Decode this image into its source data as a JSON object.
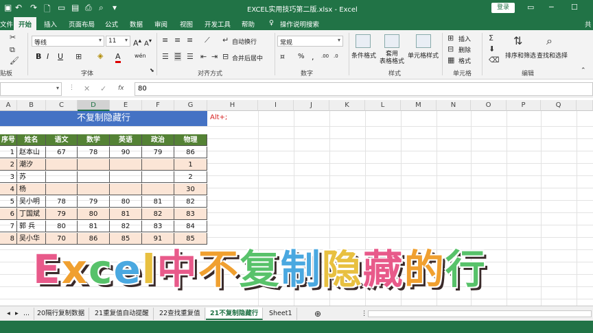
{
  "titlebar": {
    "title": "EXCEL实用技巧第二版.xlsx  -  Excel",
    "login_label": "登录"
  },
  "tabs": [
    "文件",
    "开始",
    "插入",
    "页面布局",
    "公式",
    "数据",
    "审阅",
    "视图",
    "开发工具",
    "帮助",
    "操作说明搜索",
    "共"
  ],
  "active_tab": "开始",
  "ribbon": {
    "font_name": "等线",
    "font_size": "11",
    "number_format": "常规",
    "wrap_text": "自动换行",
    "merge_center": "合并后居中",
    "cond_format": "条件格式",
    "table_format": "套用\n表格格式",
    "cell_styles": "单元格样式",
    "insert": "插入",
    "delete": "删除",
    "format": "格式",
    "sort_filter": "排序和筛选",
    "find_select": "查找和选择",
    "group_labels": {
      "clipboard": "贴板",
      "font": "字体",
      "alignment": "对齐方式",
      "number": "数字",
      "styles": "样式",
      "cells": "单元格",
      "editing": "编辑"
    }
  },
  "formula_bar": {
    "fx": "fx",
    "value": "80"
  },
  "columns": [
    "A",
    "B",
    "C",
    "D",
    "E",
    "F",
    "G",
    "H",
    "I",
    "J",
    "K",
    "L",
    "M",
    "N",
    "O",
    "P",
    "Q"
  ],
  "selected_column": "D",
  "sheet": {
    "banner": "不复制隐藏行",
    "note": "Alt+;",
    "headers": [
      "序号",
      "姓名",
      "语文",
      "数学",
      "英语",
      "政治",
      "物理"
    ],
    "rows": [
      [
        "1",
        "赵本山",
        "67",
        "78",
        "90",
        "79",
        "86"
      ],
      [
        "2",
        "潮汐",
        "",
        "",
        "",
        "",
        "1"
      ],
      [
        "3",
        "苏",
        "",
        "",
        "",
        "",
        "2"
      ],
      [
        "4",
        "杨",
        "",
        "",
        "",
        "",
        "30"
      ],
      [
        "5",
        "吴小明",
        "78",
        "79",
        "80",
        "81",
        "82"
      ],
      [
        "6",
        "丁国斌",
        "79",
        "80",
        "81",
        "82",
        "83"
      ],
      [
        "7",
        "郭  兵",
        "80",
        "81",
        "82",
        "83",
        "84"
      ],
      [
        "8",
        "吴小华",
        "70",
        "86",
        "85",
        "91",
        "85"
      ]
    ]
  },
  "overlay": {
    "chars": [
      "E",
      "x",
      "c",
      "e",
      "l",
      "中",
      "不",
      "复",
      "制",
      "隐",
      "藏",
      "的",
      "行"
    ],
    "colors": [
      "#e85a8a",
      "#f0a030",
      "#58c26a",
      "#4aa8e0",
      "#e8c040",
      "#e85a8a",
      "#f0a030",
      "#58c26a",
      "#4aa8e0",
      "#e8c040",
      "#e85a8a",
      "#f0a030",
      "#58c26a"
    ]
  },
  "sheet_tabs": [
    "...",
    "20隔行复制数据",
    "21重复值自动提醒",
    "22查找重复值",
    "21不复制隐藏行",
    "Sheet1"
  ],
  "active_sheet": "21不复制隐藏行"
}
